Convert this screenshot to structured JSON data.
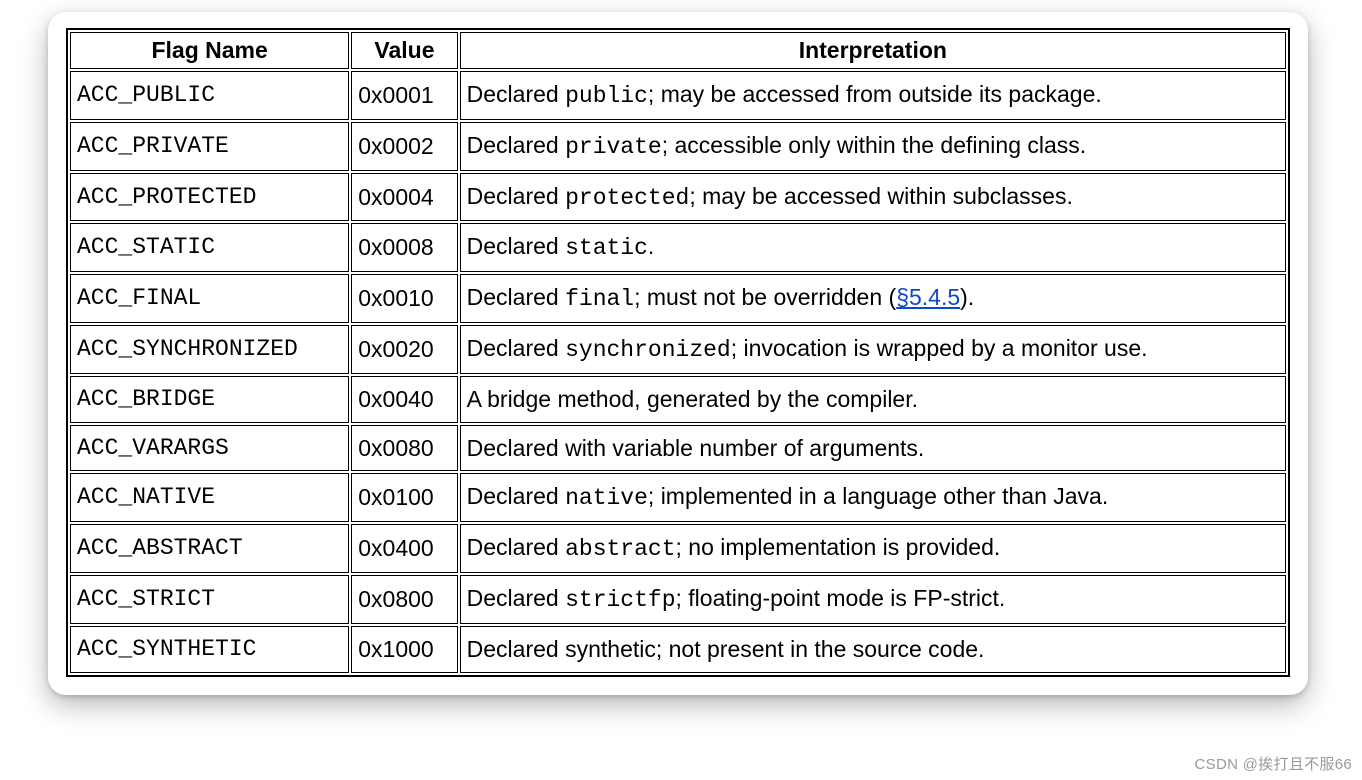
{
  "headers": {
    "flag": "Flag Name",
    "value": "Value",
    "interp": "Interpretation"
  },
  "rows": [
    {
      "flag": "ACC_PUBLIC",
      "value": "0x0001",
      "pre": "Declared ",
      "kw": "public",
      "post": "; may be accessed from outside its package.",
      "link": null
    },
    {
      "flag": "ACC_PRIVATE",
      "value": "0x0002",
      "pre": "Declared ",
      "kw": "private",
      "post": "; accessible only within the defining class.",
      "link": null
    },
    {
      "flag": "ACC_PROTECTED",
      "value": "0x0004",
      "pre": "Declared ",
      "kw": "protected",
      "post": "; may be accessed within subclasses.",
      "link": null
    },
    {
      "flag": "ACC_STATIC",
      "value": "0x0008",
      "pre": "Declared ",
      "kw": "static",
      "post": ".",
      "link": null
    },
    {
      "flag": "ACC_FINAL",
      "value": "0x0010",
      "pre": "Declared ",
      "kw": "final",
      "post": "; must not be overridden (",
      "link": "§5.4.5",
      "after_link": ")."
    },
    {
      "flag": "ACC_SYNCHRONIZED",
      "value": "0x0020",
      "pre": "Declared ",
      "kw": "synchronized",
      "post": "; invocation is wrapped by a monitor use.",
      "link": null
    },
    {
      "flag": "ACC_BRIDGE",
      "value": "0x0040",
      "pre": "A bridge method, generated by the compiler.",
      "kw": null,
      "post": "",
      "link": null
    },
    {
      "flag": "ACC_VARARGS",
      "value": "0x0080",
      "pre": "Declared with variable number of arguments.",
      "kw": null,
      "post": "",
      "link": null
    },
    {
      "flag": "ACC_NATIVE",
      "value": "0x0100",
      "pre": "Declared ",
      "kw": "native",
      "post": "; implemented in a language other than Java.",
      "link": null
    },
    {
      "flag": "ACC_ABSTRACT",
      "value": "0x0400",
      "pre": "Declared ",
      "kw": "abstract",
      "post": "; no implementation is provided.",
      "link": null
    },
    {
      "flag": "ACC_STRICT",
      "value": "0x0800",
      "pre": "Declared ",
      "kw": "strictfp",
      "post": "; floating-point mode is FP-strict.",
      "link": null
    },
    {
      "flag": "ACC_SYNTHETIC",
      "value": "0x1000",
      "pre": "Declared synthetic; not present in the source code.",
      "kw": null,
      "post": "",
      "link": null
    }
  ],
  "watermark": "CSDN @挨打且不服66"
}
